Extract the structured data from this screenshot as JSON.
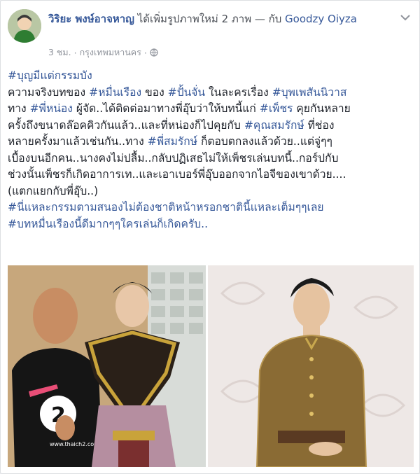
{
  "post": {
    "author": "วิริยะ พงษ์อาจหาญ",
    "action": "ได้เพิ่มรูปภาพใหม่ 2 ภาพ — กับ",
    "tagged": "Goodzy Oiyza",
    "time": "3 ชม.",
    "separator": "·",
    "location": "กรุงเทพมหานคร",
    "dropdown_icon": "chevron-down-icon",
    "privacy_icon": "globe-icon"
  },
  "body": {
    "line1_tag": "#บุญมีแต่กรรมบัง",
    "l2a": "ความจริงบทของ ",
    "l2b": "#หมื่นเรือง",
    "l2c": " ของ ",
    "l2d": "#ปั้นจั่น",
    "l2e": " ในละครเรื่อง ",
    "l2f": "#บุพเพสันนิวาส",
    "l3a": "ทาง ",
    "l3b": "#พี่หน่อง",
    "l3c": " ผู้จัด..ได้ติดต่อมาทางพี่อุ๊บว่าให้บทนี้แก่ ",
    "l3d": "#เพ็ชร",
    "l3e": " คุยกันหลาย",
    "l4a": "ครั้งถึงขนาดล๊อคคิวกันแล้ว..และที่หน่องก็ไปคุยกับ ",
    "l4b": "#คุณสมรักษ์",
    "l4c": " ที่ช่อง",
    "l5a": "หลายครั้งมาแล้วเช่นกัน..ทาง ",
    "l5b": "#พี่สมรักษ์",
    "l5c": " ก็ตอบตกลงแล้วด้วย..แต่จู่ๆๆ",
    "l6": "เบื้องบนอีกคน..นางคงไม่ปลื้ม..กลับปฏิเสธไม่ให้เพ็ชรเล่นบทนี้..กอร์ปกับ",
    "l7": "ช่วงนั้นเพ็ชรก็เกิดอาการเท..และเอาเบอร์พี่อุ๊บออกจากไอจีของเขาด้วย....",
    "l8": "(แตกแยกกับพี่อุ๊บ..)",
    "l9": "#นี่แหละกรรมตามสนองไม่ต้องชาติหน้าหรอกชาตินี้แหละเต็มๆๆเลย",
    "l10": "#บทหมื่นเรืองนี้ดีมากๆๆใครเล่นก็เกิดครับ.."
  },
  "photos": {
    "left_shirt_text": "2",
    "left_shirt_url": "www.thaich2.com"
  },
  "colors": {
    "link": "#365899",
    "text": "#1d2129",
    "meta": "#90949c",
    "background": "#e9ebee"
  }
}
